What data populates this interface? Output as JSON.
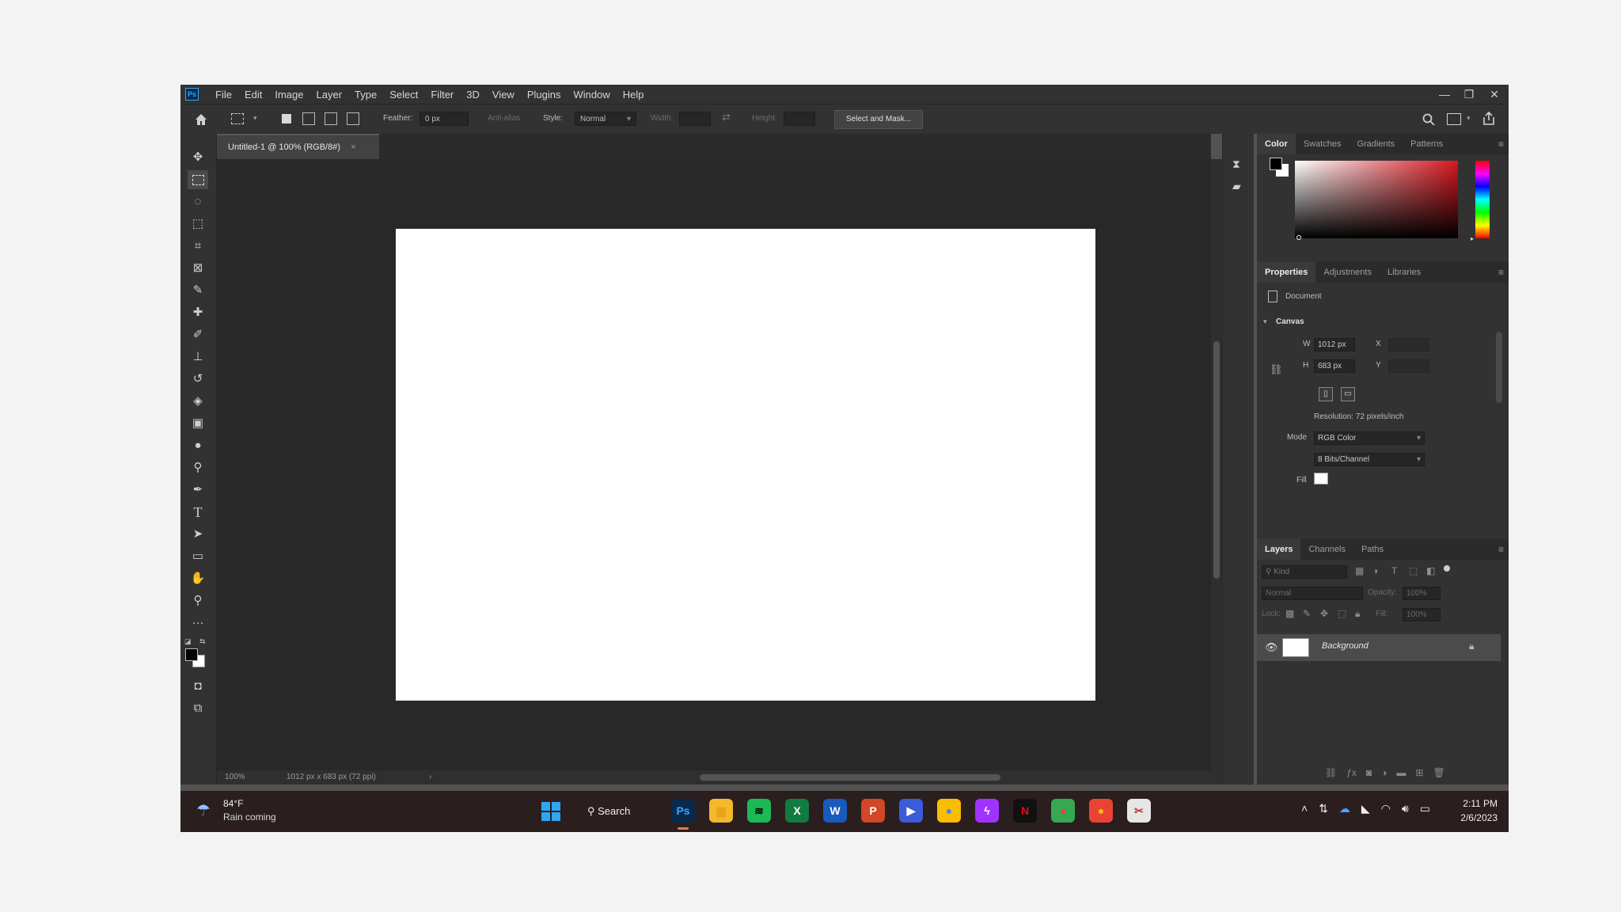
{
  "app": {
    "logo": "Ps"
  },
  "menu": [
    "File",
    "Edit",
    "Image",
    "Layer",
    "Type",
    "Select",
    "Filter",
    "3D",
    "View",
    "Plugins",
    "Window",
    "Help"
  ],
  "window_controls": {
    "minimize": "—",
    "restore": "❐",
    "close": "✕"
  },
  "options_bar": {
    "feather_label": "Feather:",
    "feather_value": "0 px",
    "antialias_label": "Anti-alias",
    "style_label": "Style:",
    "style_value": "Normal",
    "width_label": "Width:",
    "height_label": "Height:",
    "select_mask_label": "Select and Mask..."
  },
  "document": {
    "tab_title": "Untitled-1 @ 100% (RGB/8#)",
    "tab_close": "×"
  },
  "status": {
    "zoom": "100%",
    "info": "1012 px x 683 px (72 ppi)",
    "arrow": "›"
  },
  "color_panel": {
    "tabs": [
      "Color",
      "Swatches",
      "Gradients",
      "Patterns"
    ],
    "active_tab": 0
  },
  "properties_panel": {
    "tabs": [
      "Properties",
      "Adjustments",
      "Libraries"
    ],
    "active_tab": 0,
    "doc_label": "Document",
    "section": "Canvas",
    "w_label": "W",
    "w_value": "1012 px",
    "h_label": "H",
    "h_value": "683 px",
    "x_label": "X",
    "y_label": "Y",
    "resolution": "Resolution: 72 pixels/inch",
    "mode_label": "Mode",
    "mode_value": "RGB Color",
    "depth_value": "8 Bits/Channel",
    "fill_label": "Fill"
  },
  "layers_panel": {
    "tabs": [
      "Layers",
      "Channels",
      "Paths"
    ],
    "active_tab": 0,
    "search_placeholder": "Kind",
    "blend_mode": "Normal",
    "opacity_label": "Opacity:",
    "opacity_value": "100%",
    "lock_label": "Lock:",
    "fill_label": "Fill:",
    "fill_value": "100%",
    "layer_name": "Background"
  },
  "taskbar": {
    "weather_temp": "84°F",
    "weather_desc": "Rain coming",
    "search_label": "Search",
    "time": "2:11 PM",
    "date": "2/6/2023",
    "apps": [
      {
        "name": "photoshop",
        "label": "Ps",
        "color": "#0a2a4d",
        "fg": "#31a8ff"
      },
      {
        "name": "file-explorer",
        "label": "▆",
        "color": "#f3b82c",
        "fg": "#e8a317"
      },
      {
        "name": "spotify",
        "label": "≋",
        "color": "#1db954",
        "fg": "#000000"
      },
      {
        "name": "excel",
        "label": "X",
        "color": "#107c41",
        "fg": "#ffffff"
      },
      {
        "name": "word",
        "label": "W",
        "color": "#185abd",
        "fg": "#ffffff"
      },
      {
        "name": "powerpoint",
        "label": "P",
        "color": "#d24726",
        "fg": "#ffffff"
      },
      {
        "name": "media-player",
        "label": "▶",
        "color": "#3b5bdb",
        "fg": "#ffffff"
      },
      {
        "name": "chrome",
        "label": "●",
        "color": "#fbbc05",
        "fg": "#4285f4"
      },
      {
        "name": "messenger",
        "label": "ϟ",
        "color": "#a033ff",
        "fg": "#ffffff"
      },
      {
        "name": "netflix",
        "label": "N",
        "color": "#111111",
        "fg": "#e50914"
      },
      {
        "name": "chrome-profile-2",
        "label": "●",
        "color": "#34a853",
        "fg": "#ea4335"
      },
      {
        "name": "chrome-profile-3",
        "label": "●",
        "color": "#ea4335",
        "fg": "#fbbc05"
      },
      {
        "name": "snipping-tool",
        "label": "✂",
        "color": "#e6e6e6",
        "fg": "#c0392b"
      }
    ]
  },
  "colors": {
    "accent": "#31a8ff",
    "panel": "#323232",
    "canvas_bg": "#282828",
    "foreground": "#000000",
    "background": "#ffffff"
  }
}
